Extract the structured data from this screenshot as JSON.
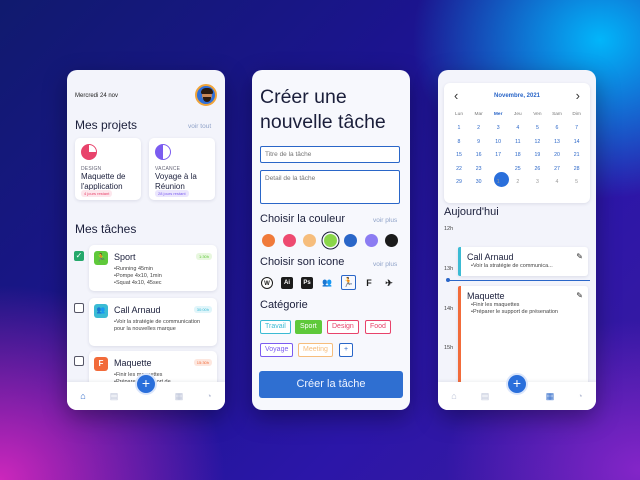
{
  "screen1": {
    "date": "Mercredi 24 nov",
    "projects_title": "Mes projets",
    "see_all": "voir tout",
    "projects": [
      {
        "category": "DESIGN",
        "name": "Maquette de l'application",
        "badge": "4 jours restant",
        "color": "#e8436b",
        "progress": 0.25
      },
      {
        "category": "VACANCE",
        "name": "Voyage à la Réunion",
        "badge": "28 jours restant",
        "color": "#7b5cf0",
        "progress": 0.5
      }
    ],
    "tasks_title": "Mes tâches",
    "tasks": [
      {
        "title": "Sport",
        "duration": "1:30h",
        "done": true,
        "icon": "running-icon",
        "color": "#5fc93a",
        "items": [
          "Running 45min",
          "Pompe 4x10, 1min",
          "Squat 4x10, 45sec"
        ]
      },
      {
        "title": "Call Arnaud",
        "duration": "30:00h",
        "done": false,
        "icon": "users-icon",
        "color": "#3bbbd4",
        "items": [
          "Voir la stratégie de communication pour la nouvelles marque"
        ]
      },
      {
        "title": "Maquette",
        "duration": "15:30h",
        "done": false,
        "icon": "figma-icon",
        "color": "#f26b3a",
        "items": [
          "Finir les maquettes",
          "Préparer le support de"
        ]
      }
    ],
    "nav": {
      "add": "+"
    }
  },
  "screen2": {
    "title": "Créer une nouvelle tâche",
    "title_placeholder": "Titre de la tâche",
    "detail_placeholder": "Detail de la tâche",
    "color_title": "Choisir la couleur",
    "color_more": "voir plus",
    "colors": [
      "#f07a3a",
      "#ee4a70",
      "#f6bd7c",
      "#8ad64a",
      "#2a66c8",
      "#8c7cf2",
      "#1b1b1b"
    ],
    "selected_color": "#8ad64a",
    "icon_title": "Choisir son icone",
    "icon_more": "voir plus",
    "icons": [
      {
        "name": "wordpress-icon",
        "glyph": "W"
      },
      {
        "name": "illustrator-icon",
        "glyph": "Ai"
      },
      {
        "name": "photoshop-icon",
        "glyph": "Ps"
      },
      {
        "name": "users-icon",
        "glyph": "👥"
      },
      {
        "name": "running-icon",
        "glyph": "🏃"
      },
      {
        "name": "figma-icon",
        "glyph": "F"
      },
      {
        "name": "plane-icon",
        "glyph": "✈"
      }
    ],
    "category_title": "Catégorie",
    "categories": [
      {
        "label": "Travail",
        "color": "#3bbbd4",
        "selected": false
      },
      {
        "label": "Sport",
        "color": "#5fc93a",
        "selected": true
      },
      {
        "label": "Design",
        "color": "#e8436b",
        "selected": false
      },
      {
        "label": "Food",
        "color": "#e8436b",
        "selected": false
      },
      {
        "label": "Voyage",
        "color": "#7b5cf0",
        "selected": false
      },
      {
        "label": "Meeting",
        "color": "#f6bd7c",
        "selected": false
      },
      {
        "label": "+",
        "color": "#2a66c8",
        "selected": false
      }
    ],
    "create_button": "Créer la tâche"
  },
  "screen3": {
    "month": "Novembre, 2021",
    "weekdays": [
      "Lun",
      "Mar",
      "Mer",
      "Jeu",
      "Ven",
      "Sam",
      "Dim"
    ],
    "weeks": [
      [
        "1",
        "2",
        "3",
        "4",
        "5",
        "6",
        "7"
      ],
      [
        "8",
        "9",
        "10",
        "11",
        "12",
        "13",
        "14"
      ],
      [
        "15",
        "16",
        "17",
        "18",
        "19",
        "20",
        "21"
      ],
      [
        "22",
        "23",
        "24",
        "25",
        "26",
        "27",
        "28"
      ],
      [
        "29",
        "30",
        "1",
        "2",
        "3",
        "4",
        "5"
      ]
    ],
    "selected_day": "24",
    "today_title": "Aujourd'hui",
    "hours": [
      "12h",
      "13h",
      "14h",
      "15h"
    ],
    "events": [
      {
        "title": "Call Arnaud",
        "color": "#3bbbd4",
        "items": [
          "Voir la stratégie de communica..."
        ]
      },
      {
        "title": "Maquette",
        "color": "#f26b3a",
        "items": [
          "Finir les maquettes",
          "Préparer le support de présenation"
        ]
      }
    ],
    "nav": {
      "add": "+"
    }
  }
}
